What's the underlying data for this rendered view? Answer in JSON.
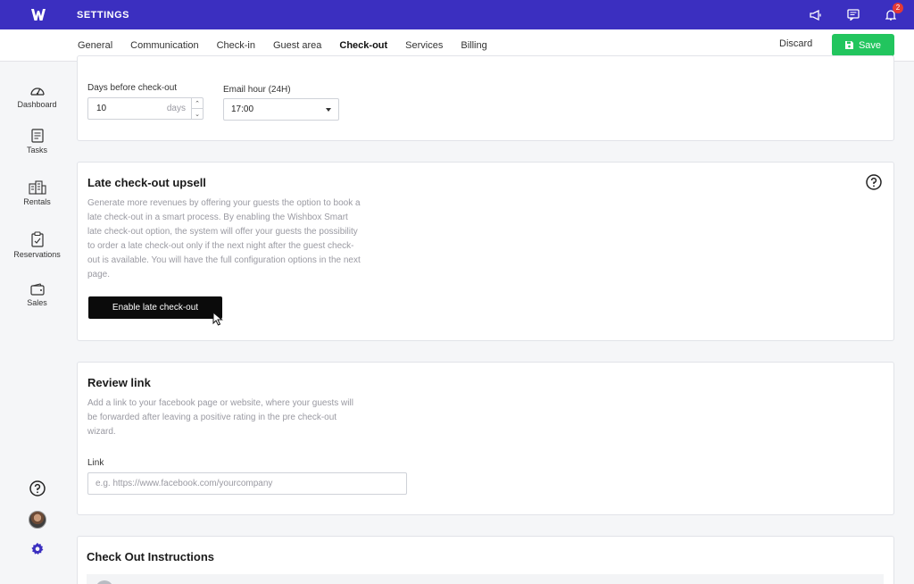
{
  "topbar": {
    "title": "SETTINGS",
    "notification_count": "2",
    "brand_color": "#3b2fc0"
  },
  "tabs": [
    {
      "label": "General"
    },
    {
      "label": "Communication"
    },
    {
      "label": "Check-in"
    },
    {
      "label": "Guest area"
    },
    {
      "label": "Check-out",
      "active": true
    },
    {
      "label": "Services"
    },
    {
      "label": "Billing"
    }
  ],
  "actions": {
    "discard_label": "Discard",
    "save_label": "Save"
  },
  "sidebar": {
    "items": [
      {
        "label": "Dashboard",
        "icon": "dashboard-icon"
      },
      {
        "label": "Tasks",
        "icon": "tasks-icon"
      },
      {
        "label": "Rentals",
        "icon": "rentals-icon"
      },
      {
        "label": "Reservations",
        "icon": "reservations-icon"
      },
      {
        "label": "Sales",
        "icon": "wallet-icon"
      }
    ]
  },
  "reminder": {
    "days_label": "Days before check-out",
    "days_value": "10",
    "days_unit": "days",
    "hour_label": "Email hour (24H)",
    "hour_value": "17:00"
  },
  "late_checkout": {
    "title": "Late check-out upsell",
    "description": "Generate more revenues by offering your guests the option to book a late check-out in a smart process. By enabling the Wishbox Smart late check-out option, the system will offer your guests the possibility to order a late check-out only if the next night after the guest check-out is available. You will have the full configuration options in the next page.",
    "button_label": "Enable late check-out"
  },
  "review": {
    "title": "Review link",
    "description": "Add a link to your facebook page or website, where your guests will be forwarded after leaving a positive rating in the pre check-out wizard.",
    "link_label": "Link",
    "link_placeholder": "e.g. https://www.facebook.com/yourcompany"
  },
  "instructions": {
    "title": "Check Out Instructions"
  },
  "colors": {
    "accent": "#3b2fc0",
    "save_green": "#22c55e",
    "dark_button": "#0b0b0b"
  }
}
